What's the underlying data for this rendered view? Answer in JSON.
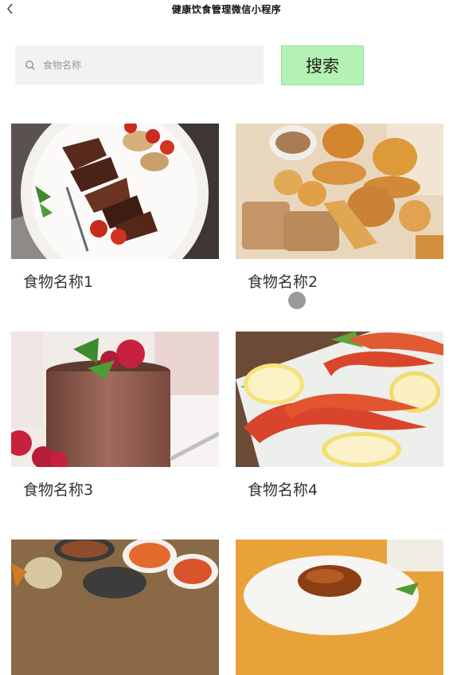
{
  "header": {
    "title": "健康饮食管理微信小程序"
  },
  "search": {
    "placeholder": "食物名称",
    "value": "",
    "button_label": "搜索"
  },
  "foods": [
    {
      "name": "食物名称1",
      "image": "grilled steak with tomatoes and onions"
    },
    {
      "name": "食物名称2",
      "image": "assorted breads"
    },
    {
      "name": "食物名称3",
      "image": "chocolate cake with raspberries"
    },
    {
      "name": "食物名称4",
      "image": "grilled shrimp with lemon"
    },
    {
      "name": "",
      "image": "korean side dishes"
    },
    {
      "name": "",
      "image": "braised meat dish"
    }
  ],
  "colors": {
    "search_button_bg": "#b3f2b3",
    "search_bg": "#f2f2f2"
  },
  "icons": {
    "back": "chevron-left-icon",
    "search": "search-icon"
  }
}
